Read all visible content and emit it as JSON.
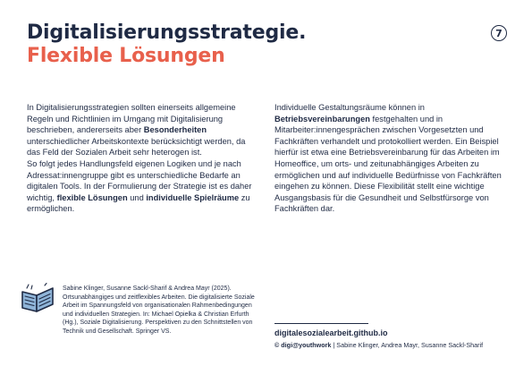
{
  "header": {
    "title_line1": "Digitalisierungsstrategie.",
    "title_line2": "Flexible Lösungen",
    "page_number": "7"
  },
  "left_column": {
    "p1_a": "In Digitalisierungsstrategien sollten einerseits allgemeine Regeln und Richtlinien im Umgang mit Digitalisierung beschrieben, andererseits aber ",
    "p1_bold": "Besonderheiten",
    "p1_b": " unterschiedlicher Arbeitskontexte berücksichtigt werden, da das Feld der Sozialen Arbeit sehr heterogen ist.",
    "p2_a": "So folgt jedes Handlungsfeld eigenen Logiken und je nach Adressat:innengruppe gibt es unterschiedliche Bedarfe an digitalen Tools. In der Formulierung der Strategie ist es daher wichtig, ",
    "p2_bold1": "flexible Lösungen",
    "p2_mid": " und ",
    "p2_bold2": "individuelle Spielräume",
    "p2_b": " zu ermöglichen."
  },
  "right_column": {
    "p1_a": "Individuelle Gestaltungsräume können in ",
    "p1_bold": "Betriebsvereinbarungen",
    "p1_b": " festgehalten und in Mitarbeiter:innengesprächen zwischen Vorgesetzten und Fachkräften verhandelt und protokolliert werden. Ein Beispiel hierfür ist etwa eine Betriebsvereinbarung für das Arbeiten im Homeoffice, um orts- und zeitunabhängiges Arbeiten zu ermöglichen und auf individuelle Bedürfnisse von Fachkräften eingehen zu können. Diese Flexibilität stellt eine wichtige Ausgangsbasis für die Gesundheit und Selbstfürsorge von Fachkräften dar."
  },
  "reference": {
    "text": "Sabine Klinger, Susanne Sackl-Sharif & Andrea Mayr (2025). Ortsunabhängiges und zeitflexibles Arbeiten. Die digitalisierte Soziale Arbeit im Spannungsfeld von organisationalen Rahmenbedingungen und individuellen Strategien. In: Michael Opielka & Christian Erfurth (Hg.), Soziale Digitalisierung. Perspektiven zu den Schnittstellen von Technik und Gesellschaft. Springer VS."
  },
  "footer": {
    "website": "digitalesozialearbeit.github.io",
    "credit_bold": "© digi@youthwork",
    "credit_rest": " | Sabine Klinger, Andrea Mayr, Susanne Sackl-Sharif"
  },
  "colors": {
    "navy": "#1f2a44",
    "accent": "#e8604c",
    "icon_blue": "#8fb4d8"
  }
}
